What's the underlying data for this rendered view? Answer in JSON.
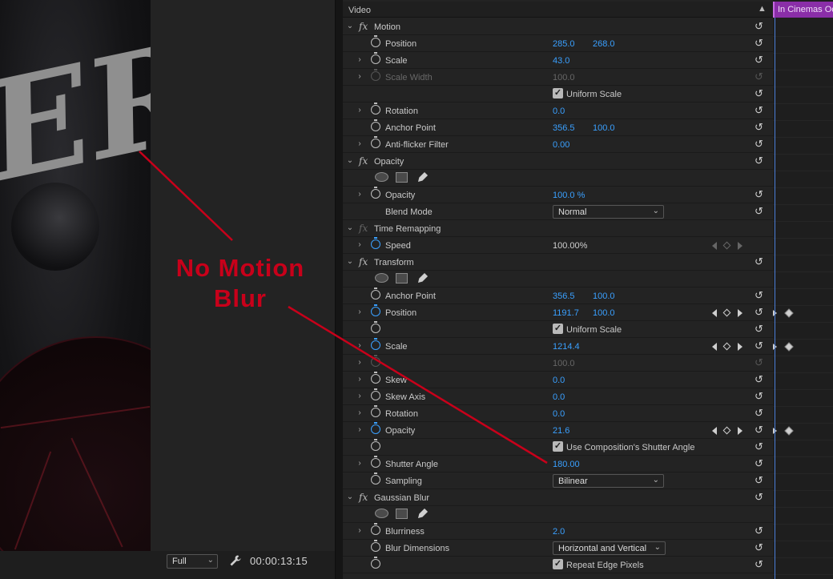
{
  "monitor": {
    "resolution": "Full",
    "timecode": "00:00:13:15"
  },
  "effects": {
    "header": "Video",
    "rows": [
      {
        "kind": "effect",
        "label": "Motion",
        "twirl": "open"
      },
      {
        "kind": "prop",
        "label": "Position",
        "v1": "285.0",
        "v2": "268.0"
      },
      {
        "kind": "prop",
        "label": "Scale",
        "v1": "43.0",
        "twirl": "closed"
      },
      {
        "kind": "prop",
        "label": "Scale Width",
        "v1": "100.0",
        "twirl": "closed",
        "dim": true
      },
      {
        "kind": "check",
        "label": "Uniform Scale",
        "no_sw": true
      },
      {
        "kind": "prop",
        "label": "Rotation",
        "v1": "0.0",
        "twirl": "closed"
      },
      {
        "kind": "prop",
        "label": "Anchor Point",
        "v1": "356.5",
        "v2": "100.0"
      },
      {
        "kind": "prop",
        "label": "Anti-flicker Filter",
        "v1": "0.00",
        "twirl": "closed"
      },
      {
        "kind": "effect",
        "label": "Opacity",
        "twirl": "open"
      },
      {
        "kind": "shapes"
      },
      {
        "kind": "prop",
        "label": "Opacity",
        "v1": "100.0 %",
        "twirl": "closed"
      },
      {
        "kind": "dropdown",
        "label": "Blend Mode",
        "value": "Normal",
        "no_sw": true
      },
      {
        "kind": "effect",
        "label": "Time Remapping",
        "twirl": "open",
        "dimfx": true,
        "no_reset": true
      },
      {
        "kind": "prop",
        "label": "Speed",
        "v1": "100.00%",
        "twirl": "closed",
        "white": true,
        "sw_on": true,
        "kf": "dim",
        "no_reset": true
      },
      {
        "kind": "effect",
        "label": "Transform",
        "twirl": "open"
      },
      {
        "kind": "shapes"
      },
      {
        "kind": "prop",
        "label": "Anchor Point",
        "v1": "356.5",
        "v2": "100.0"
      },
      {
        "kind": "prop",
        "label": "Position",
        "v1": "1191.7",
        "v2": "100.0",
        "twirl": "closed",
        "sw_on": true,
        "kf": "on"
      },
      {
        "kind": "check",
        "label": "Uniform Scale"
      },
      {
        "kind": "prop",
        "label": "Scale",
        "v1": "1214.4",
        "twirl": "closed",
        "sw_on": true,
        "kf": "on"
      },
      {
        "kind": "prop",
        "label": "",
        "v1": "100.0",
        "twirl": "closed",
        "dim": true
      },
      {
        "kind": "prop",
        "label": "Skew",
        "v1": "0.0",
        "twirl": "closed"
      },
      {
        "kind": "prop",
        "label": "Skew Axis",
        "v1": "0.0",
        "twirl": "closed"
      },
      {
        "kind": "prop",
        "label": "Rotation",
        "v1": "0.0",
        "twirl": "closed"
      },
      {
        "kind": "prop",
        "label": "Opacity",
        "v1": "21.6",
        "twirl": "closed",
        "sw_on": true,
        "kf": "on"
      },
      {
        "kind": "check",
        "label": "Use Composition's Shutter Angle"
      },
      {
        "kind": "prop",
        "label": "Shutter Angle",
        "v1": "180.00",
        "twirl": "closed"
      },
      {
        "kind": "dropdown",
        "label": "Sampling",
        "value": "Bilinear"
      },
      {
        "kind": "effect",
        "label": "Gaussian Blur",
        "twirl": "open"
      },
      {
        "kind": "shapes"
      },
      {
        "kind": "prop",
        "label": "Blurriness",
        "v1": "2.0",
        "twirl": "closed"
      },
      {
        "kind": "dropdown",
        "label": "Blur Dimensions",
        "value": "Horizontal and Vertical",
        "wide": true
      },
      {
        "kind": "check",
        "label": "Repeat Edge Pixels"
      }
    ]
  },
  "timeline": {
    "clip_label": "In Cinemas Oct"
  },
  "annotation": {
    "line1": "No Motion",
    "line2": "Blur",
    "color": "#c8001a"
  },
  "colors": {
    "value_blue": "#3aa0ff",
    "clip_purple": "#8a2ea8",
    "playhead": "#4b7fd9"
  }
}
